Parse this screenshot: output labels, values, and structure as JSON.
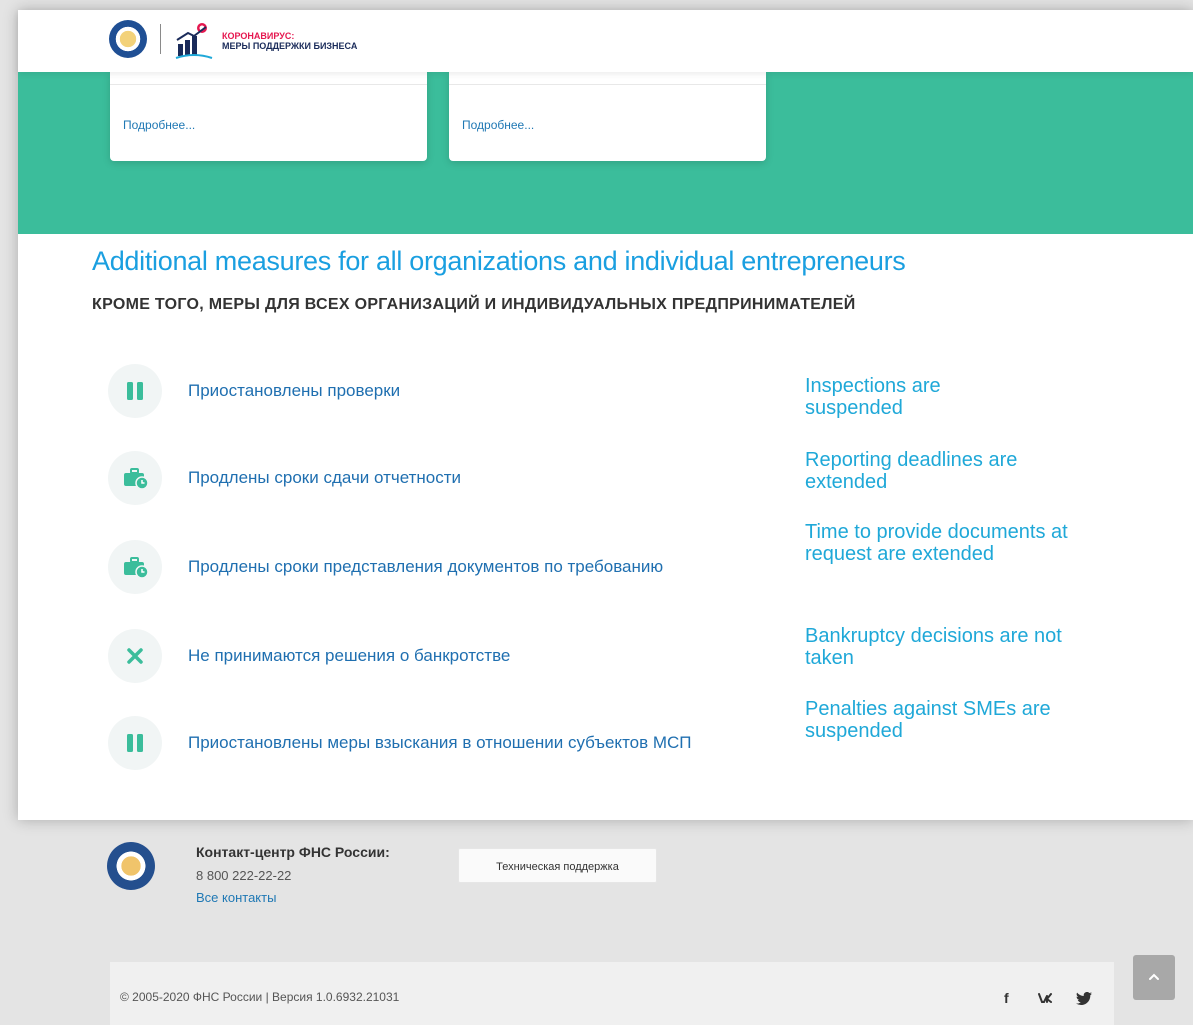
{
  "header": {
    "logo_line1": "КОРОНАВИРУС:",
    "logo_line2": "МЕРЫ ПОДДЕРЖКИ БИЗНЕСА"
  },
  "cards": [
    {
      "link": "Подробнее..."
    },
    {
      "link": "Подробнее..."
    }
  ],
  "section": {
    "title_en": "Additional measures for all organizations and individual entrepreneurs",
    "title_ru": "КРОМЕ ТОГО, МЕРЫ ДЛЯ ВСЕХ ОРГАНИЗАЦИЙ И ИНДИВИДУАЛЬНЫХ ПРЕДПРИНИМАТЕЛЕЙ"
  },
  "measures": [
    {
      "icon": "pause-icon",
      "label": "Приостановлены проверки",
      "note_en": "Inspections are suspended"
    },
    {
      "icon": "briefcase-clock-icon",
      "label": "Продлены сроки сдачи отчетности",
      "note_en": "Reporting deadlines are extended"
    },
    {
      "icon": "briefcase-clock-icon",
      "label": "Продлены сроки представления документов по требованию",
      "note_en": "Time to provide documents at request are extended"
    },
    {
      "icon": "close-icon",
      "label": "Не принимаются решения о банкротстве",
      "note_en": "Bankruptcy decisions are not taken"
    },
    {
      "icon": "pause-icon",
      "label": "Приостановлены меры взыскания в отношении субъектов МСП",
      "note_en": "Penalties against SMEs are suspended"
    }
  ],
  "footer": {
    "contact_title": "Контакт-центр ФНС России:",
    "phone": "8 800 222-22-22",
    "all_contacts": "Все контакты",
    "support_button": "Техническая поддержка",
    "copyright": "© 2005-2020 ФНС России | Версия 1.0.6932.21031",
    "social": {
      "facebook": "f",
      "vk": "vk",
      "twitter": "twitter-icon"
    }
  },
  "colors": {
    "teal": "#3bbd9b",
    "link_blue": "#1f78b4",
    "heading_blue": "#1a9fe0",
    "note_blue": "#1fa8d8",
    "brand_red": "#e5174f"
  }
}
